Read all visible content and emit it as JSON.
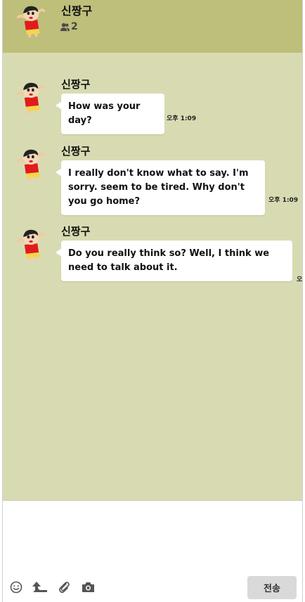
{
  "header": {
    "title": "신짱구",
    "member_count": "2"
  },
  "messages": [
    {
      "sender": "신짱구",
      "text": "How was your day?",
      "time": "오후 1:09"
    },
    {
      "sender": "신짱구",
      "text": "I really don't know what to say. I'm sorry. seem to be tired. Why don't you go home?",
      "time": "오후 1:09"
    },
    {
      "sender": "신짱구",
      "text": "Do you really think so? Well, I think we need to talk about it.",
      "time": "오"
    }
  ],
  "composer": {
    "value": "",
    "send_label": "전송",
    "icons": [
      "emoji-icon",
      "share-icon",
      "attach-icon",
      "camera-icon"
    ]
  },
  "colors": {
    "header_bg": "#bdbf7a",
    "chat_bg": "#d8dbb2",
    "bubble_bg": "#ffffff"
  }
}
